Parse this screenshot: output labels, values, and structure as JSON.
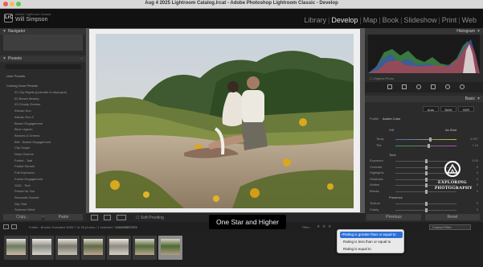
{
  "window": {
    "title": "Aug 4 2025 Lightroom Catalog.lrcat - Adobe Photoshop Lightroom Classic - Develop"
  },
  "identity": {
    "logo": "LrC",
    "subtitle": "Adobe Lightroom Classic",
    "name": "Will Simpson"
  },
  "modules": [
    "Library",
    "Develop",
    "Map",
    "Book",
    "Slideshow",
    "Print",
    "Web"
  ],
  "active_module": "Develop",
  "left_panel": {
    "navigator_header": "Navigator",
    "presets_header": "Presets",
    "groups": [
      {
        "label": "User Presets"
      },
      {
        "label": "Coming Soon Presets"
      }
    ],
    "preset_items": [
      "01 City Nights (portraits in cityscape)",
      "02 Beach Beauty",
      "03 Cloudy Greens",
      "African Sun",
      "African Sun 2",
      "Beach Engagement",
      "Blue Lagoon",
      "Browns & Greens",
      "BW - Beach Engagement",
      "City Scape",
      "Deep Greens",
      "Faded - Teal",
      "Faded Sunset",
      "Fall Explosion",
      "Forest Engagement",
      "G&D - Teal",
      "Preset for You",
      "Romantic Sunset",
      "Sky Teal",
      "Summer Wind",
      "Wedding Preset 2 (Good fan)"
    ],
    "copy_label": "Copy...",
    "paste_label": "Paste"
  },
  "toolbar": {
    "soft_proofing_label": "Soft Proofing"
  },
  "tooltip": {
    "text": "One Star and Higher"
  },
  "right_panel": {
    "histogram_label": "Histogram",
    "original_photo_label": "Original Photo",
    "basic_label": "Basic",
    "auto_label": "Auto",
    "bw_label": "B&W",
    "hdr_label": "HDR",
    "profile_label": "Profile",
    "profile_value": "Adobe Color",
    "wb_label": "WB",
    "wb_value": "As Shot",
    "temp_label": "Temp",
    "temp_value": "4,957",
    "tint_label": "Tint",
    "tint_value": "+ 16",
    "tone_label": "Tone",
    "tone_sliders": [
      {
        "label": "Exposure",
        "value": "0.00"
      },
      {
        "label": "Contrast",
        "value": "0"
      },
      {
        "label": "Highlights",
        "value": "0"
      },
      {
        "label": "Shadows",
        "value": "0"
      },
      {
        "label": "Whites",
        "value": "0"
      },
      {
        "label": "Blacks",
        "value": "0"
      }
    ],
    "presence_label": "Presence",
    "presence_sliders": [
      {
        "label": "Texture",
        "value": "0"
      },
      {
        "label": "Clarity",
        "value": "0"
      }
    ],
    "previous_label": "Previous",
    "reset_label": "Reset"
  },
  "filmstrip_bar": {
    "folder_text": "Folder : Brooke Gonzalez RAW",
    "count_text": "7 of 28 photos / 1 selected /",
    "filename": "V2AH4557CR3",
    "filter_label": "Filter :",
    "custom_filter_label": "Custom Filter"
  },
  "rating_menu": {
    "items": [
      "Rating is greater than or equal to",
      "Rating is less than or equal to",
      "Rating is equal to"
    ],
    "selected_index": 0
  },
  "filmstrip": {
    "thumb_count": 7,
    "selected_index": 6
  },
  "watermark": {
    "line1": "EXPLORING",
    "line2": "PHOTOGRAPHY"
  }
}
